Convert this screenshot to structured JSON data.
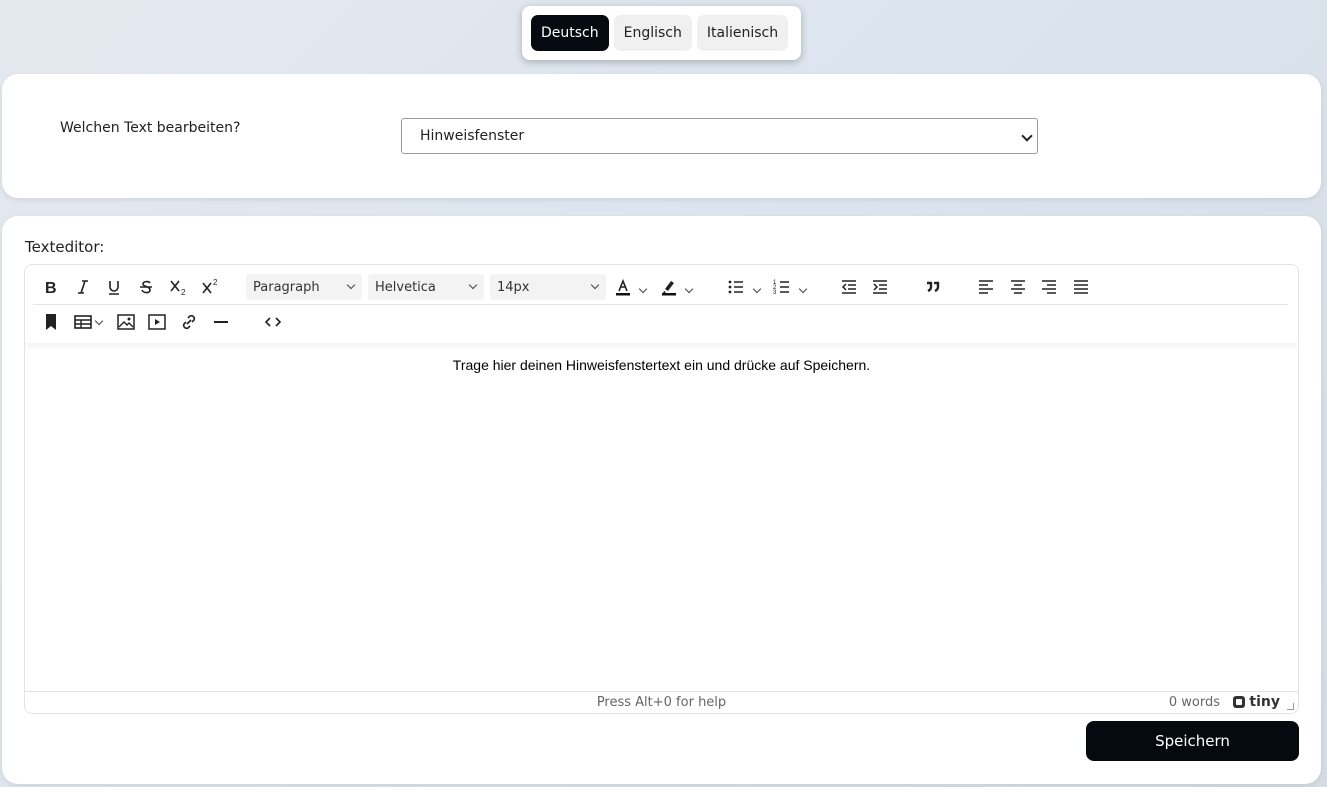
{
  "language_tabs": [
    {
      "label": "Deutsch",
      "active": true
    },
    {
      "label": "Englisch",
      "active": false
    },
    {
      "label": "Italienisch",
      "active": false
    }
  ],
  "text_select": {
    "label": "Welchen Text bearbeiten?",
    "value": "Hinweisfenster"
  },
  "editor": {
    "heading": "Texteditor:",
    "toolbar": {
      "block_format": "Paragraph",
      "font_family": "Helvetica",
      "font_size": "14px",
      "buttons": [
        "bold-icon",
        "italic-icon",
        "underline-icon",
        "strikethrough-icon",
        "subscript-icon",
        "superscript-icon",
        "text-color-icon",
        "highlight-icon",
        "bullet-list-icon",
        "numbered-list-icon",
        "outdent-icon",
        "indent-icon",
        "blockquote-icon",
        "align-left-icon",
        "align-center-icon",
        "align-right-icon",
        "align-justify-icon",
        "bookmark-icon",
        "table-icon",
        "image-icon",
        "media-icon",
        "link-icon",
        "horizontal-line-icon",
        "source-code-icon"
      ]
    },
    "content": "Trage hier deinen Hinweisfenstertext ein und drücke auf Speichern.",
    "status_help": "Press Alt+0 for help",
    "word_count": "0 words",
    "brand": "tiny"
  },
  "save_button": "Speichern",
  "colors": {
    "primary": "#050a10",
    "background": "#dde5ee"
  }
}
